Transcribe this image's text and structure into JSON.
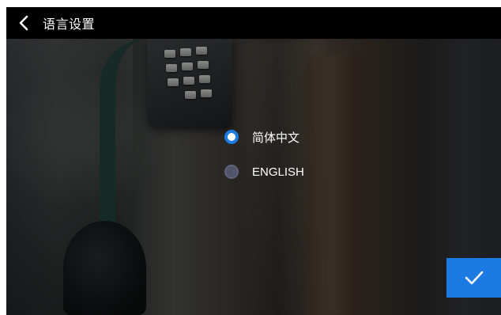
{
  "header": {
    "title": "语言设置",
    "back_icon": "chevron-left-icon"
  },
  "languages": {
    "selected_index": 0,
    "items": [
      {
        "label": "简体中文",
        "selected": true
      },
      {
        "label": "ENGLISH",
        "selected": false
      }
    ]
  },
  "confirm": {
    "icon": "checkmark-icon"
  },
  "colors": {
    "accent": "#1b7be3",
    "header_bg": "#000000",
    "text": "#ffffff",
    "radio_unselected": "#52556a"
  }
}
